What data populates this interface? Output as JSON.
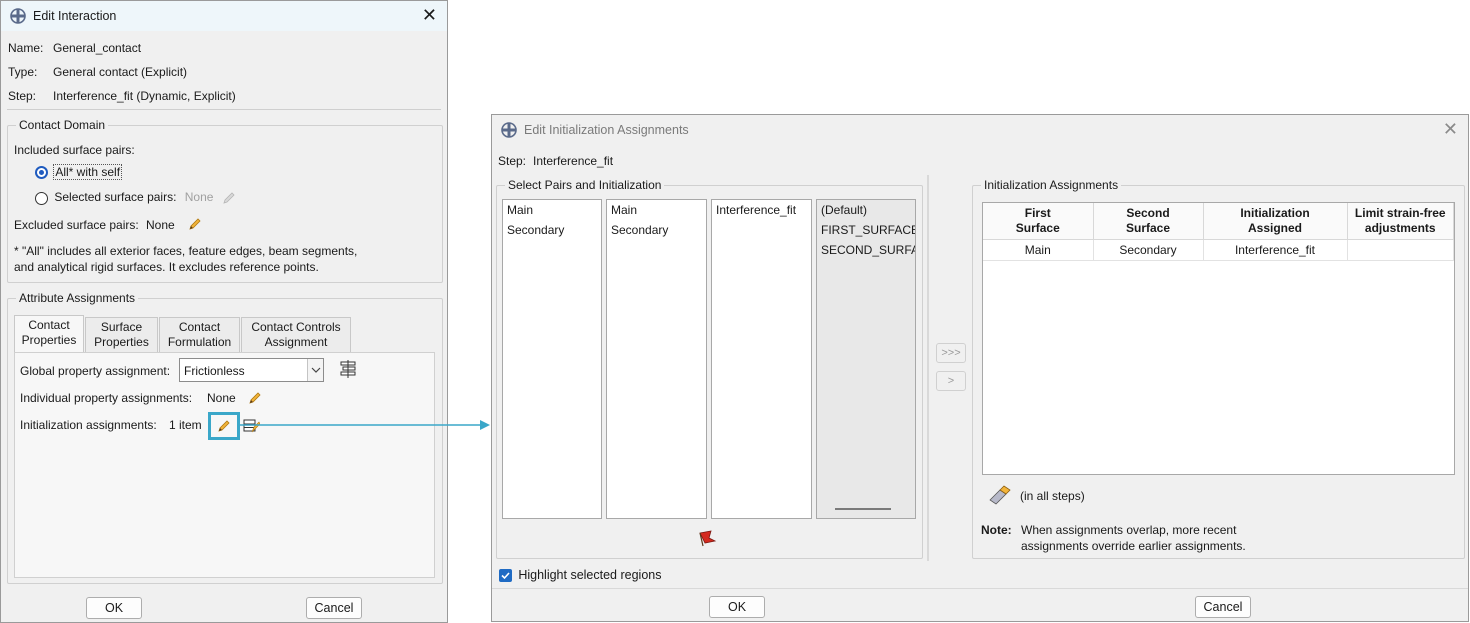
{
  "edit_interaction": {
    "title": "Edit Interaction",
    "name_label": "Name:",
    "name_value": "General_contact",
    "type_label": "Type:",
    "type_value": "General contact (Explicit)",
    "step_label": "Step:",
    "step_value": "Interference_fit (Dynamic, Explicit)",
    "contact_domain": {
      "title": "Contact Domain",
      "included_label": "Included surface pairs:",
      "option_all": "All* with self",
      "option_selected": "Selected surface pairs:",
      "selected_value": "None",
      "excluded_label": "Excluded surface pairs:",
      "excluded_value": "None",
      "footnote_line1": "* \"All\" includes all exterior faces, feature edges, beam segments,",
      "footnote_line2": "and analytical rigid surfaces. It excludes reference points."
    },
    "attribute_assignments": {
      "title": "Attribute Assignments",
      "tabs": [
        {
          "line1": "Contact",
          "line2": "Properties"
        },
        {
          "line1": "Surface",
          "line2": "Properties"
        },
        {
          "line1": "Contact",
          "line2": "Formulation"
        },
        {
          "line1": "Contact Controls",
          "line2": "Assignment"
        }
      ],
      "global_label": "Global property assignment:",
      "global_value": "Frictionless",
      "individual_label": "Individual property assignments:",
      "individual_value": "None",
      "init_label": "Initialization assignments:",
      "init_value": "1 item"
    },
    "ok_label": "OK",
    "cancel_label": "Cancel"
  },
  "edit_init": {
    "title": "Edit Initialization Assignments",
    "step_label": "Step:",
    "step_value": "Interference_fit",
    "select_group_title": "Select Pairs and Initialization",
    "list1": [
      "Main",
      "Secondary"
    ],
    "list2": [
      "Main",
      "Secondary"
    ],
    "list3": [
      "Interference_fit"
    ],
    "list4": [
      "(Default)",
      "FIRST_SURFACE",
      "SECOND_SURFACE"
    ],
    "add_all_label": ">>>",
    "add_label": ">",
    "assign_group_title": "Initialization Assignments",
    "table_headers": [
      {
        "line1": "First",
        "line2": "Surface"
      },
      {
        "line1": "Second",
        "line2": "Surface"
      },
      {
        "line1": "Initialization",
        "line2": "Assigned"
      },
      {
        "line1": "Limit strain-free",
        "line2": "adjustments"
      }
    ],
    "table_rows": [
      [
        "Main",
        "Secondary",
        "Interference_fit",
        ""
      ]
    ],
    "in_all_steps": "(in all steps)",
    "note_label": "Note:",
    "note_line1": "When assignments overlap, more recent",
    "note_line2": "assignments override earlier assignments.",
    "highlight_label": "Highlight selected regions",
    "ok_label": "OK",
    "cancel_label": "Cancel"
  },
  "colors": {
    "callout": "#3aa7c9",
    "accent": "#1f5bbf",
    "pencil": "#e8a317"
  },
  "icons": [
    "app-icon",
    "close-icon",
    "pencil-icon",
    "property-manager-icon",
    "init-manager-icon",
    "flag-icon",
    "eraser-icon",
    "check-icon",
    "chevron-down-icon"
  ]
}
